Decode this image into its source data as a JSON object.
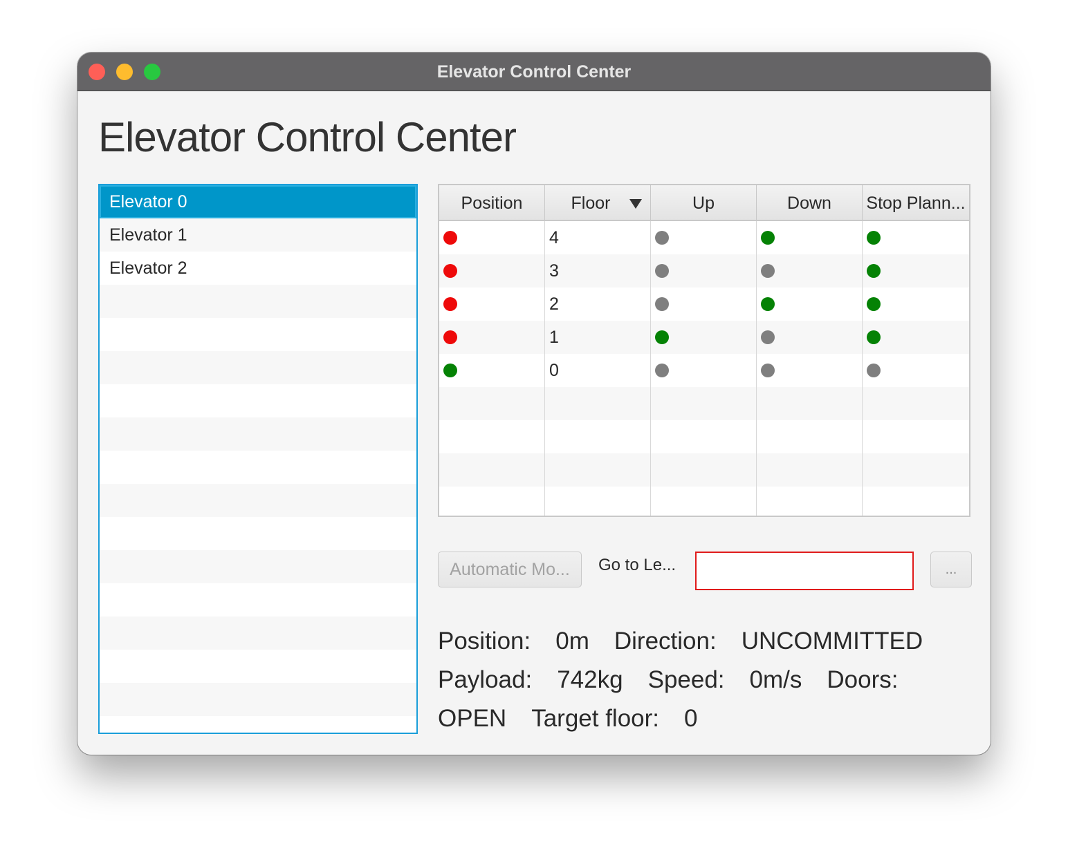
{
  "window": {
    "title": "Elevator Control Center"
  },
  "page": {
    "heading": "Elevator Control Center"
  },
  "elevator_list": {
    "items": [
      {
        "label": "Elevator 0",
        "selected": true
      },
      {
        "label": "Elevator 1",
        "selected": false
      },
      {
        "label": "Elevator 2",
        "selected": false
      }
    ]
  },
  "floor_table": {
    "columns": [
      "Position",
      "Floor",
      "Up",
      "Down",
      "Stop Plann..."
    ],
    "sorted_column": "Floor",
    "rows": [
      {
        "position": "red",
        "floor": "4",
        "up": "gray",
        "down": "green",
        "stop": "green"
      },
      {
        "position": "red",
        "floor": "3",
        "up": "gray",
        "down": "gray",
        "stop": "green"
      },
      {
        "position": "red",
        "floor": "2",
        "up": "gray",
        "down": "green",
        "stop": "green"
      },
      {
        "position": "red",
        "floor": "1",
        "up": "green",
        "down": "gray",
        "stop": "green"
      },
      {
        "position": "green",
        "floor": "0",
        "up": "gray",
        "down": "gray",
        "stop": "gray"
      }
    ]
  },
  "controls": {
    "automatic_button": "Automatic Mo...",
    "goto_label": "Go to Le...",
    "goto_value": "",
    "more_button": "..."
  },
  "status": {
    "position_label": "Position:",
    "position_value": "0m",
    "direction_label": "Direction:",
    "direction_value": "UNCOMMITTED",
    "payload_label": "Payload:",
    "payload_value": "742kg",
    "speed_label": "Speed:",
    "speed_value": "0m/s",
    "doors_label": "Doors:",
    "doors_value": "OPEN",
    "target_label": "Target floor:",
    "target_value": "0"
  },
  "colors": {
    "red": "#ee0a0a",
    "green": "#058205",
    "gray": "#7f7f7f",
    "selection": "#0096c9",
    "input_error_border": "#e01b1b"
  }
}
